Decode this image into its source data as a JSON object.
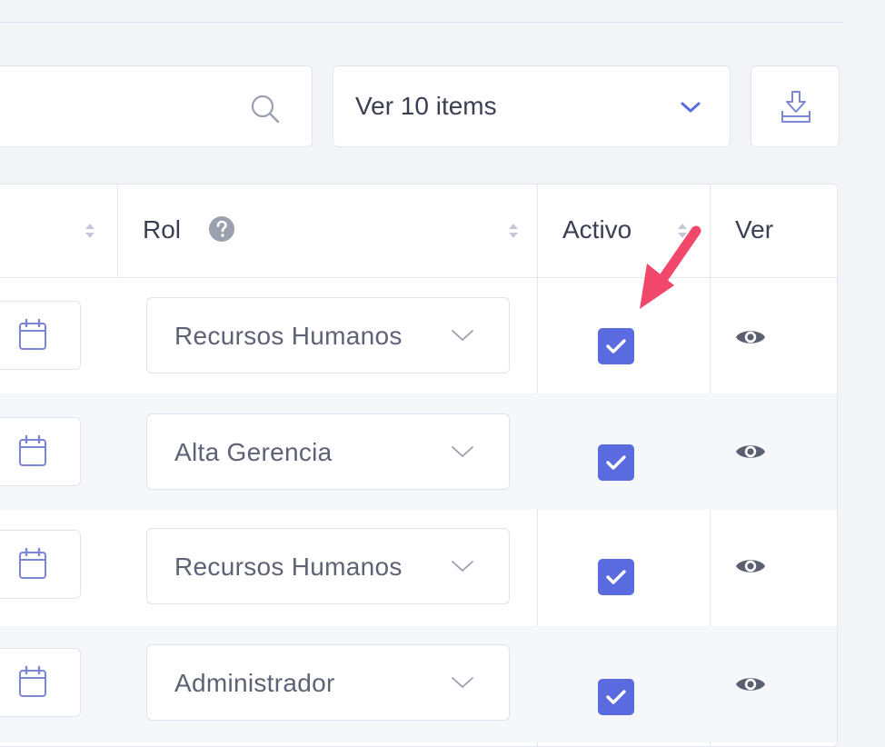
{
  "toolbar": {
    "search_placeholder": "",
    "page_size_label": "Ver 10 items"
  },
  "table": {
    "headers": {
      "rol": "Rol",
      "activo": "Activo",
      "ver": "Ver"
    },
    "rows": [
      {
        "role": "Recursos Humanos",
        "active": true
      },
      {
        "role": "Alta Gerencia",
        "active": true
      },
      {
        "role": "Recursos Humanos",
        "active": true
      },
      {
        "role": "Administrador",
        "active": true
      }
    ]
  },
  "colors": {
    "accent": "#5a6be0",
    "annotation_arrow": "#f0476b",
    "icon_outline": "#7b86d6"
  },
  "icons": [
    "search-icon",
    "chevron-down-icon",
    "download-icon",
    "sort-icon",
    "help-icon",
    "calendar-icon",
    "check-icon",
    "eye-icon",
    "arrow-annotation"
  ]
}
